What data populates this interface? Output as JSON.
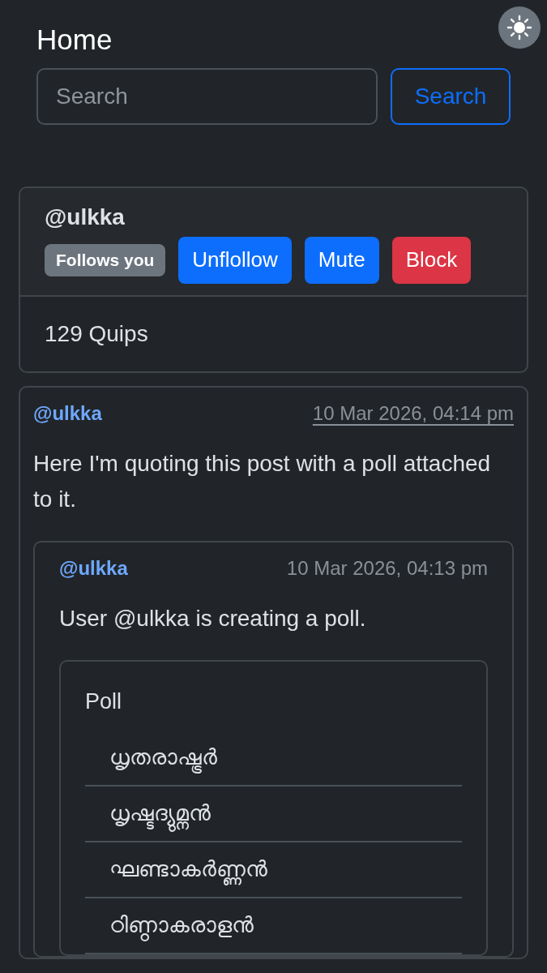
{
  "page": {
    "title": "Home"
  },
  "search": {
    "placeholder": "Search",
    "button": "Search"
  },
  "profile": {
    "handle": "@ulkka",
    "badge": "Follows you",
    "actions": [
      {
        "label": "Unflollow",
        "kind": "primary"
      },
      {
        "label": "Mute",
        "kind": "primary"
      },
      {
        "label": "Block",
        "kind": "danger"
      }
    ],
    "quips": "129 Quips"
  },
  "post": {
    "author": "@ulkka",
    "time": "10 Mar 2026, 04:14 pm",
    "text": "Here I'm quoting this post with a poll attached to it.",
    "quote": {
      "author": "@ulkka",
      "time": "10 Mar 2026, 04:13 pm",
      "text": "User @ulkka is creating a poll.",
      "poll": {
        "title": "Poll",
        "options": [
          "ധൃതരാഷ്ട്രർ",
          "ധൃഷ്ടദ്യുമ്നൻ",
          "ഘണ്ടാകർണ്ണൻ",
          "ഠിണ്ഠാകരാളൻ"
        ]
      }
    }
  }
}
